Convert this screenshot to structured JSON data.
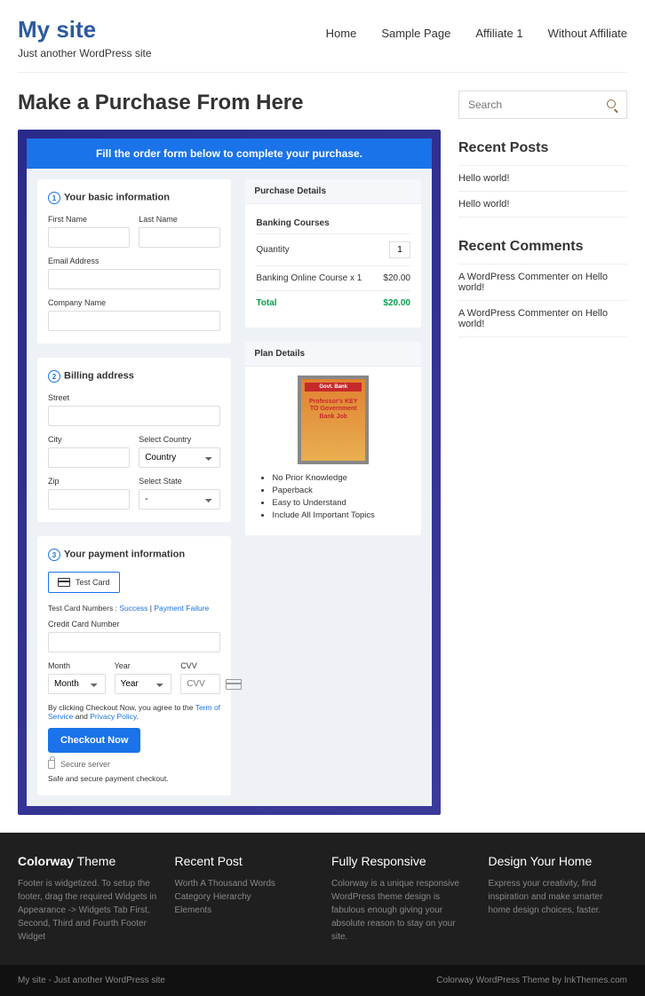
{
  "header": {
    "site_title": "My site",
    "tagline": "Just another WordPress site",
    "nav": [
      "Home",
      "Sample Page",
      "Affiliate 1",
      "Without Affiliate"
    ]
  },
  "page": {
    "title": "Make a Purchase From Here"
  },
  "order": {
    "banner": "Fill the order form below to complete your purchase.",
    "basic": {
      "title": "Your basic information",
      "first_name": "First Name",
      "last_name": "Last Name",
      "email": "Email Address",
      "company": "Company Name"
    },
    "billing": {
      "title": "Billing address",
      "street": "Street",
      "city": "City",
      "select_country": "Select Country",
      "country_ph": "Country",
      "zip": "Zip",
      "select_state": "Select State",
      "state_ph": "-"
    },
    "payment": {
      "title": "Your payment information",
      "test_card": "Test  Card",
      "tc_prefix": "Test Card Numbers : ",
      "tc_success": "Success",
      "tc_sep": " | ",
      "tc_failure": "Payment Failure",
      "cc_label": "Credit Card Number",
      "month": "Month",
      "month_ph": "Month",
      "year": "Year",
      "year_ph": "Year",
      "cvv": "CVV",
      "cvv_ph": "CVV",
      "agree_prefix": "By clicking Checkout Now, you agree to the ",
      "tos": "Term of Service",
      "agree_and": " and ",
      "privacy": "Privacy Policy",
      "agree_suffix": ".",
      "checkout_btn": "Checkout Now",
      "secure": "Secure server",
      "safe_note": "Safe and secure payment checkout."
    },
    "details": {
      "title": "Purchase Details",
      "course_header": "Banking Courses",
      "qty_label": "Quantity",
      "qty_value": "1",
      "line_item": "Banking Online Course x 1",
      "line_price": "$20.00",
      "total_label": "Total",
      "total_value": "$20.00"
    },
    "plan": {
      "title": "Plan Details",
      "img_top": "Govt. Bank",
      "img_mid": "Professor's KEY TO Government Bank Job",
      "bullets": [
        "No Prior Knowledge",
        "Paperback",
        "Easy to Understand",
        "Include All Important Topics"
      ]
    }
  },
  "sidebar": {
    "search_ph": "Search",
    "recent_posts_title": "Recent Posts",
    "recent_posts": [
      "Hello world!",
      "Hello world!"
    ],
    "recent_comments_title": "Recent Comments",
    "rc1_a": "A WordPress Commenter",
    "rc1_on": " on ",
    "rc1_b": "Hello world!",
    "rc2_a": "A WordPress Commenter",
    "rc2_on": " on ",
    "rc2_b": "Hello world!"
  },
  "footer": {
    "col1_b": "Colorway",
    "col1_r": " Theme",
    "col1_text": "Footer is widgetized. To setup the footer, drag the required Widgets in Appearance -> Widgets Tab First, Second, Third and Fourth Footer Widget",
    "col2_title": "Recent Post",
    "col2_l1": "Worth A Thousand Words",
    "col2_l2": "Category Hierarchy",
    "col2_l3": "Elements",
    "col3_title": "Fully Responsive",
    "col3_text": "Colorway is a unique responsive WordPress theme design is fabulous enough giving your absolute reason to stay on your site.",
    "col4_title": "Design Your Home",
    "col4_text": "Express your creativity, find inspiration and make smarter home design choices, faster.",
    "bar_left": "My site - Just another WordPress site",
    "bar_right": "Colorway WordPress Theme by InkThemes.com"
  }
}
